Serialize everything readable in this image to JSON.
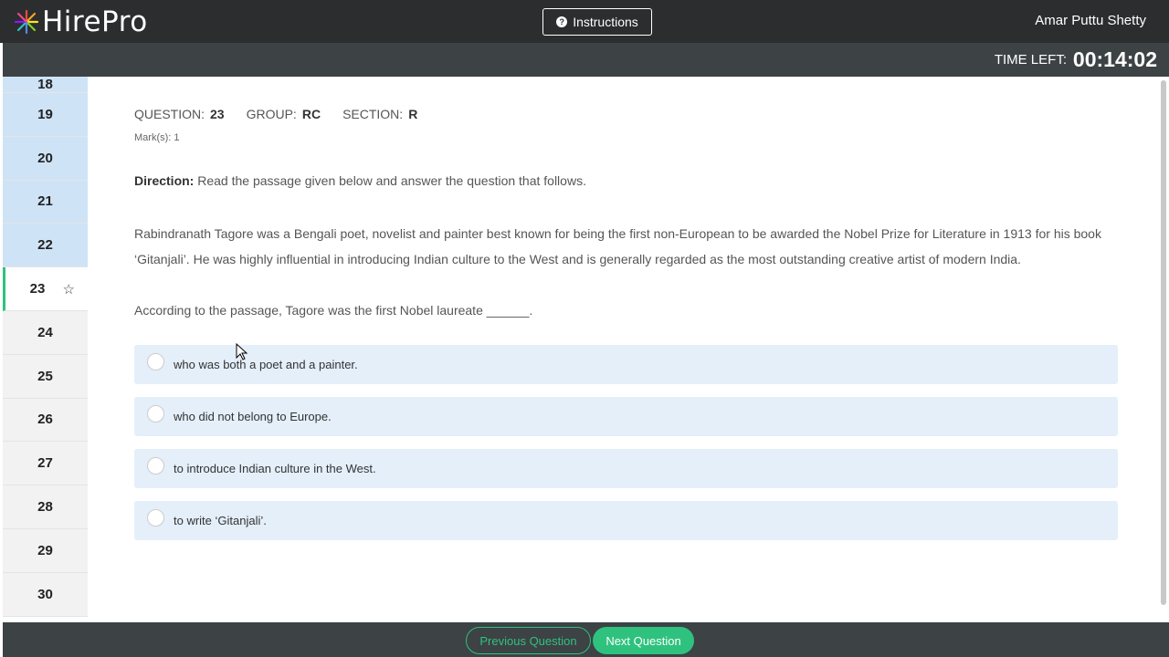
{
  "header": {
    "logo_text": "HirePro",
    "instructions_label": "Instructions",
    "user_name": "Amar Puttu Shetty"
  },
  "timer": {
    "label": "TIME LEFT:",
    "value": "00:14:02"
  },
  "sidebar": {
    "items": [
      {
        "number": "18",
        "state": "answered"
      },
      {
        "number": "19",
        "state": "answered"
      },
      {
        "number": "20",
        "state": "answered"
      },
      {
        "number": "21",
        "state": "answered"
      },
      {
        "number": "22",
        "state": "answered"
      },
      {
        "number": "23",
        "state": "current"
      },
      {
        "number": "24",
        "state": "unvisited"
      },
      {
        "number": "25",
        "state": "unvisited"
      },
      {
        "number": "26",
        "state": "unvisited"
      },
      {
        "number": "27",
        "state": "unvisited"
      },
      {
        "number": "28",
        "state": "unvisited"
      },
      {
        "number": "29",
        "state": "unvisited"
      },
      {
        "number": "30",
        "state": "unvisited"
      }
    ]
  },
  "question": {
    "question_label": "QUESTION:",
    "question_number": "23",
    "group_label": "GROUP:",
    "group_value": "RC",
    "section_label": "SECTION:",
    "section_value": "R",
    "marks": "Mark(s):  1",
    "direction_label": "Direction:",
    "direction_text": " Read the passage given below and answer the question that follows.",
    "passage": "Rabindranath Tagore was a Bengali poet, novelist and painter best known for being the first non-European to be awarded the Nobel Prize for Literature in 1913 for his book ‘Gitanjali’. He was highly influential in introducing Indian culture to the West and is generally regarded as the most outstanding creative artist of modern India.",
    "prompt": "According to the passage, Tagore was the first Nobel laureate ______.",
    "options": [
      "who was both a poet and a painter.",
      "who did not belong to Europe.",
      "to introduce Indian culture in the West.",
      "to write ‘Gitanjali’."
    ]
  },
  "footer": {
    "previous_label": "Previous Question",
    "next_label": "Next Question"
  },
  "colors": {
    "accent": "#2ec27e",
    "topbar": "#2b2d2f",
    "option_bg": "#e4effa",
    "answered_bg": "#cfe3f7"
  }
}
